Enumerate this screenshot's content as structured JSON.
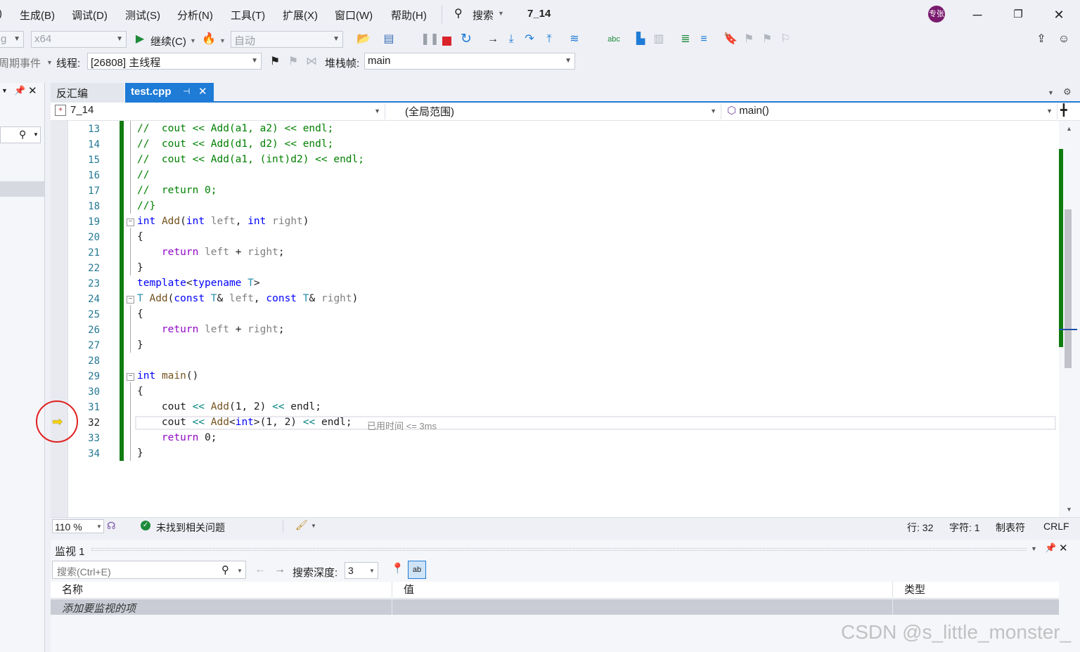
{
  "menu": {
    "items": [
      "生成(B)",
      "调试(D)",
      "测试(S)",
      "分析(N)",
      "工具(T)",
      "扩展(X)",
      "窗口(W)",
      "帮助(H)"
    ],
    "search_label": "搜索",
    "solution_name": "7_14",
    "avatar_text": "专张"
  },
  "toolbar1": {
    "config_partial": "g",
    "platform": "x64",
    "continue_label": "继续(C)",
    "auto_combo": "自动"
  },
  "toolbar2": {
    "lifecycle_label": "周期事件",
    "thread_label": "线程:",
    "thread_value": "[26808] 主线程",
    "stackframe_label": "堆栈帧:",
    "stackframe_value": "main"
  },
  "tabs": {
    "disasm": "反汇编",
    "active": "test.cpp"
  },
  "navbar": {
    "project": "7_14",
    "scope": "(全局范围)",
    "member": "main()"
  },
  "code_lines": [
    {
      "no": "13",
      "text": "//  cout << Add(a1, a2) << endl;"
    },
    {
      "no": "14",
      "text": "//  cout << Add(d1, d2) << endl;"
    },
    {
      "no": "15",
      "text": "//  cout << Add(a1, (int)d2) << endl;"
    },
    {
      "no": "16",
      "text": "//"
    },
    {
      "no": "17",
      "text": "//  return 0;"
    },
    {
      "no": "18",
      "text": "//}"
    },
    {
      "no": "19",
      "text": "int Add(int left, int right)"
    },
    {
      "no": "20",
      "text": "{"
    },
    {
      "no": "21",
      "text": "    return left + right;"
    },
    {
      "no": "22",
      "text": "}"
    },
    {
      "no": "23",
      "text": "template<typename T>"
    },
    {
      "no": "24",
      "text": "T Add(const T& left, const T& right)"
    },
    {
      "no": "25",
      "text": "{"
    },
    {
      "no": "26",
      "text": "    return left + right;"
    },
    {
      "no": "27",
      "text": "}"
    },
    {
      "no": "28",
      "text": ""
    },
    {
      "no": "29",
      "text": "int main()"
    },
    {
      "no": "30",
      "text": "{"
    },
    {
      "no": "31",
      "text": "    cout << Add(1, 2) << endl;"
    },
    {
      "no": "32",
      "text": "    cout << Add<int>(1, 2) << endl;"
    },
    {
      "no": "33",
      "text": "    return 0;"
    },
    {
      "no": "34",
      "text": "}"
    }
  ],
  "perf_hint": "已用时间 <= 3ms",
  "editor_status": {
    "zoom": "110 %",
    "issues": "未找到相关问题",
    "line": "行: 32",
    "char": "字符: 1",
    "tabs": "制表符",
    "eol": "CRLF"
  },
  "watch": {
    "title": "监视 1",
    "search_placeholder": "搜索(Ctrl+E)",
    "depth_label": "搜索深度:",
    "depth_value": "3",
    "col_name": "名称",
    "col_value": "值",
    "col_type": "类型",
    "add_item": "添加要监视的项"
  },
  "watermark": "CSDN @s_little_monster_",
  "colors": {
    "accent": "#1e7bd6",
    "change_bar": "#107c10",
    "breakpoint_circle": "#e02020",
    "arrow": "#f5d000"
  }
}
